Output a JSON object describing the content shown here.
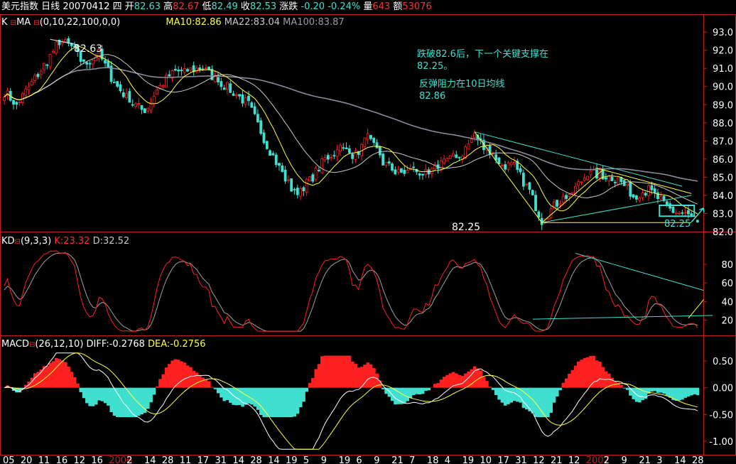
{
  "header": {
    "name": "美元指数",
    "period": "日线",
    "date": "20070412",
    "weekday": "四",
    "open_label": "开",
    "open": "82.63",
    "high_label": "高",
    "high": "82.67",
    "low_label": "低",
    "low": "82.49",
    "close_label": "收",
    "close": "82.53",
    "change_label": "涨跌",
    "change": "-0.20",
    "change_pct": "-0.24%",
    "vol_label": "量",
    "vol": "643",
    "amt_label": "额",
    "amt": "53076"
  },
  "main_legend": {
    "prefix": "K",
    "ma_name": "MA",
    "params": "(0,10,22,100,0,0)",
    "ma10": "MA10:82.86",
    "ma22": "MA22:83.04",
    "ma100": "MA100:83.87"
  },
  "kd_legend": {
    "name": "KD",
    "params": "(9,3,3)",
    "k": "K:23.32",
    "d": "D:32.52"
  },
  "macd_legend": {
    "name": "MACD",
    "params": "(26,12,10)",
    "diff": "DIFF:-0.2768",
    "dea": "DEA:-0.2756"
  },
  "annotations": {
    "note1_line1": "跌破82.6后，下一个关键支撑在",
    "note1_line2": "82.25。",
    "note2_line1": "反弹阻力在10日均线",
    "note2_line2": "82.86",
    "label_high": "82.63",
    "label_low": "82.25",
    "label_target": "82.25"
  },
  "date_axis": [
    "05",
    "20",
    "11",
    "16",
    "12",
    "16",
    "2006",
    "2",
    "14",
    "28",
    "11",
    "17",
    "31",
    "14",
    "28",
    "14",
    "19",
    "5",
    "9",
    "19",
    "6",
    "9",
    "21",
    "7",
    "18",
    "4",
    "19",
    "10",
    "17",
    "31",
    "12",
    "21",
    "12",
    "2007",
    "2",
    "9",
    "21",
    "3",
    "14",
    "28"
  ],
  "colors": {
    "up": "#ff2020",
    "down": "#40e0d0",
    "ma10": "#ffff40",
    "ma22": "#c8c8c8",
    "ma100": "#8a8a9a",
    "k_line": "#ff2020",
    "d_line": "#a0a0a0",
    "trend": "#40e0d0",
    "support": "#ffff40",
    "axis": "#c02020"
  },
  "chart_data": [
    {
      "type": "candlestick",
      "title": "美元指数 日线",
      "y_ticks": [
        82.0,
        83.0,
        84.0,
        85.0,
        86.0,
        87.0,
        88.0,
        89.0,
        90.0,
        91.0,
        92.0,
        93.0
      ],
      "ylim": [
        82.0,
        93.2
      ],
      "anchors": [
        {
          "i": 0,
          "close": 89.7
        },
        {
          "i": 4,
          "close": 89.0
        },
        {
          "i": 9,
          "close": 90.2
        },
        {
          "i": 14,
          "close": 91.4
        },
        {
          "i": 18,
          "close": 92.5
        },
        {
          "i": 22,
          "close": 92.2
        },
        {
          "i": 26,
          "close": 91.2
        },
        {
          "i": 31,
          "close": 91.8
        },
        {
          "i": 36,
          "close": 90.2
        },
        {
          "i": 41,
          "close": 89.2
        },
        {
          "i": 46,
          "close": 88.6
        },
        {
          "i": 50,
          "close": 89.8
        },
        {
          "i": 55,
          "close": 90.8
        },
        {
          "i": 60,
          "close": 90.9
        },
        {
          "i": 65,
          "close": 91.0
        },
        {
          "i": 70,
          "close": 90.3
        },
        {
          "i": 75,
          "close": 89.7
        },
        {
          "i": 80,
          "close": 89.0
        },
        {
          "i": 86,
          "close": 86.8
        },
        {
          "i": 91,
          "close": 85.2
        },
        {
          "i": 95,
          "close": 84.1
        },
        {
          "i": 100,
          "close": 84.8
        },
        {
          "i": 105,
          "close": 86.0
        },
        {
          "i": 110,
          "close": 86.6
        },
        {
          "i": 115,
          "close": 86.2
        },
        {
          "i": 119,
          "close": 87.2
        },
        {
          "i": 124,
          "close": 85.8
        },
        {
          "i": 129,
          "close": 85.2
        },
        {
          "i": 134,
          "close": 85.4
        },
        {
          "i": 139,
          "close": 85.1
        },
        {
          "i": 144,
          "close": 86.0
        },
        {
          "i": 149,
          "close": 86.1
        },
        {
          "i": 154,
          "close": 87.3
        },
        {
          "i": 158,
          "close": 86.6
        },
        {
          "i": 163,
          "close": 85.7
        },
        {
          "i": 167,
          "close": 85.6
        },
        {
          "i": 172,
          "close": 84.2
        },
        {
          "i": 176,
          "close": 82.6
        },
        {
          "i": 181,
          "close": 83.6
        },
        {
          "i": 186,
          "close": 84.2
        },
        {
          "i": 191,
          "close": 85.2
        },
        {
          "i": 196,
          "close": 85.1
        },
        {
          "i": 201,
          "close": 84.9
        },
        {
          "i": 206,
          "close": 84.0
        },
        {
          "i": 211,
          "close": 84.3
        },
        {
          "i": 215,
          "close": 83.7
        },
        {
          "i": 219,
          "close": 83.1
        },
        {
          "i": 224,
          "close": 82.9
        },
        {
          "i": 227,
          "close": 82.53
        }
      ]
    },
    {
      "type": "line",
      "title": "KD(9,3,3)",
      "y_ticks": [
        20,
        40,
        60,
        80
      ],
      "ylim": [
        5,
        100
      ],
      "series": [
        {
          "name": "K"
        },
        {
          "name": "D"
        }
      ],
      "last_values": {
        "K": 23.32,
        "D": 32.52
      }
    },
    {
      "type": "bar",
      "title": "MACD(26,12,10)",
      "y_ticks": [
        0.5,
        0.0,
        -0.5,
        -1.0
      ],
      "ylim": [
        -1.2,
        0.7
      ],
      "series": [
        {
          "name": "DIFF"
        },
        {
          "name": "DEA"
        }
      ],
      "last_values": {
        "DIFF": -0.2768,
        "DEA": -0.2756
      }
    }
  ]
}
